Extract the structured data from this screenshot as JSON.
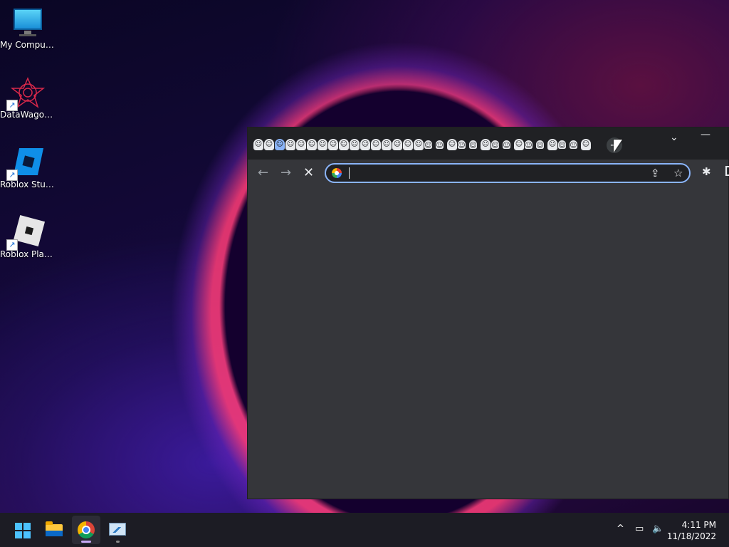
{
  "desktop": {
    "icons": [
      {
        "label": "My Computer",
        "icon": "computer-monitor-icon"
      },
      {
        "label": "DataWagon...",
        "icon": "datawagon-icon"
      },
      {
        "label": "Roblox Studio",
        "icon": "roblox-studio-icon"
      },
      {
        "label": "Roblox Player",
        "icon": "roblox-player-icon"
      }
    ]
  },
  "browser": {
    "tabs": {
      "count": 31,
      "active_index": 2,
      "favicon_glyph": "☺",
      "newtab_label": "+"
    },
    "tab_search_glyph": "⌄",
    "minimize_glyph": "—",
    "toolbar": {
      "back_glyph": "←",
      "forward_glyph": "→",
      "stop_glyph": "✕",
      "address_value": "",
      "share_glyph": "⇪",
      "bookmark_glyph": "☆",
      "extensions_glyph": "✱"
    },
    "colors": {
      "frame": "#202124",
      "content": "#35363a",
      "focus_ring": "#8ab4f8"
    }
  },
  "taskbar": {
    "apps": [
      "start-button",
      "file-explorer",
      "google-chrome",
      "task-manager"
    ],
    "tray": {
      "chevron_glyph": "^",
      "network_glyph": "▭",
      "volume_glyph": "🔈"
    },
    "clock": {
      "time": "4:11 PM",
      "date": "11/18/2022"
    }
  }
}
